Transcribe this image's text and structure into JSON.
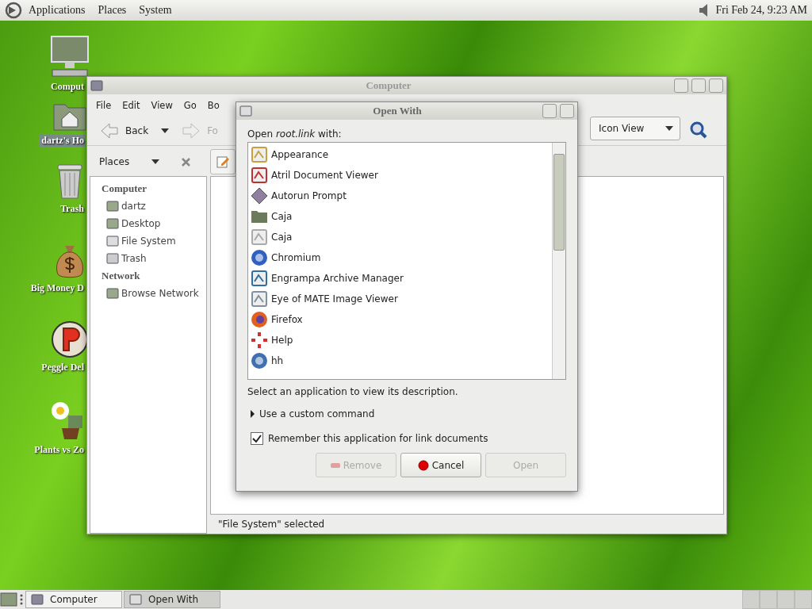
{
  "top_panel": {
    "menus": [
      "Applications",
      "Places",
      "System"
    ],
    "clock": "Fri Feb 24,  9:23 AM"
  },
  "desktop_icons": [
    {
      "label": "Comput",
      "selected": false
    },
    {
      "label": "dartz's Ho",
      "selected": true
    },
    {
      "label": "Trash",
      "selected": false
    },
    {
      "label": "Big Money D",
      "selected": false
    },
    {
      "label": "Peggle Del",
      "selected": false
    },
    {
      "label": "Plants vs Zo",
      "selected": false
    }
  ],
  "file_manager": {
    "title": "Computer",
    "menu": [
      "File",
      "Edit",
      "View",
      "Go",
      "Bo"
    ],
    "toolbar": {
      "back": "Back",
      "forward": "Fo",
      "view_mode": "Icon View"
    },
    "sidebar": {
      "header": "Places",
      "sections": [
        {
          "heading": "Computer",
          "items": [
            "dartz",
            "Desktop",
            "File System",
            "Trash"
          ]
        },
        {
          "heading": "Network",
          "items": [
            "Browse Network"
          ]
        }
      ]
    },
    "status": "\"File System\" selected"
  },
  "dialog": {
    "title": "Open With",
    "prompt": "Open *root.link* with:",
    "apps": [
      "Appearance",
      "Atril Document Viewer",
      "Autorun Prompt",
      "Caja",
      "Caja",
      "Chromium",
      "Engrampa Archive Manager",
      "Eye of MATE Image Viewer",
      "Firefox",
      "Help",
      "hh"
    ],
    "description": "Select an application to view its description.",
    "expander": {
      "label": "Use a custom command",
      "expanded": false
    },
    "remember": {
      "label": "Remember this application for link documents",
      "checked": true
    },
    "buttons": [
      {
        "label": "Remove",
        "kind": "remove",
        "disabled": true
      },
      {
        "label": "Cancel",
        "kind": "cancel",
        "disabled": false
      },
      {
        "label": "Open",
        "kind": "open",
        "disabled": true
      }
    ]
  },
  "taskbar": [
    {
      "label": "Computer",
      "selected": false
    },
    {
      "label": "Open With",
      "selected": true
    }
  ]
}
